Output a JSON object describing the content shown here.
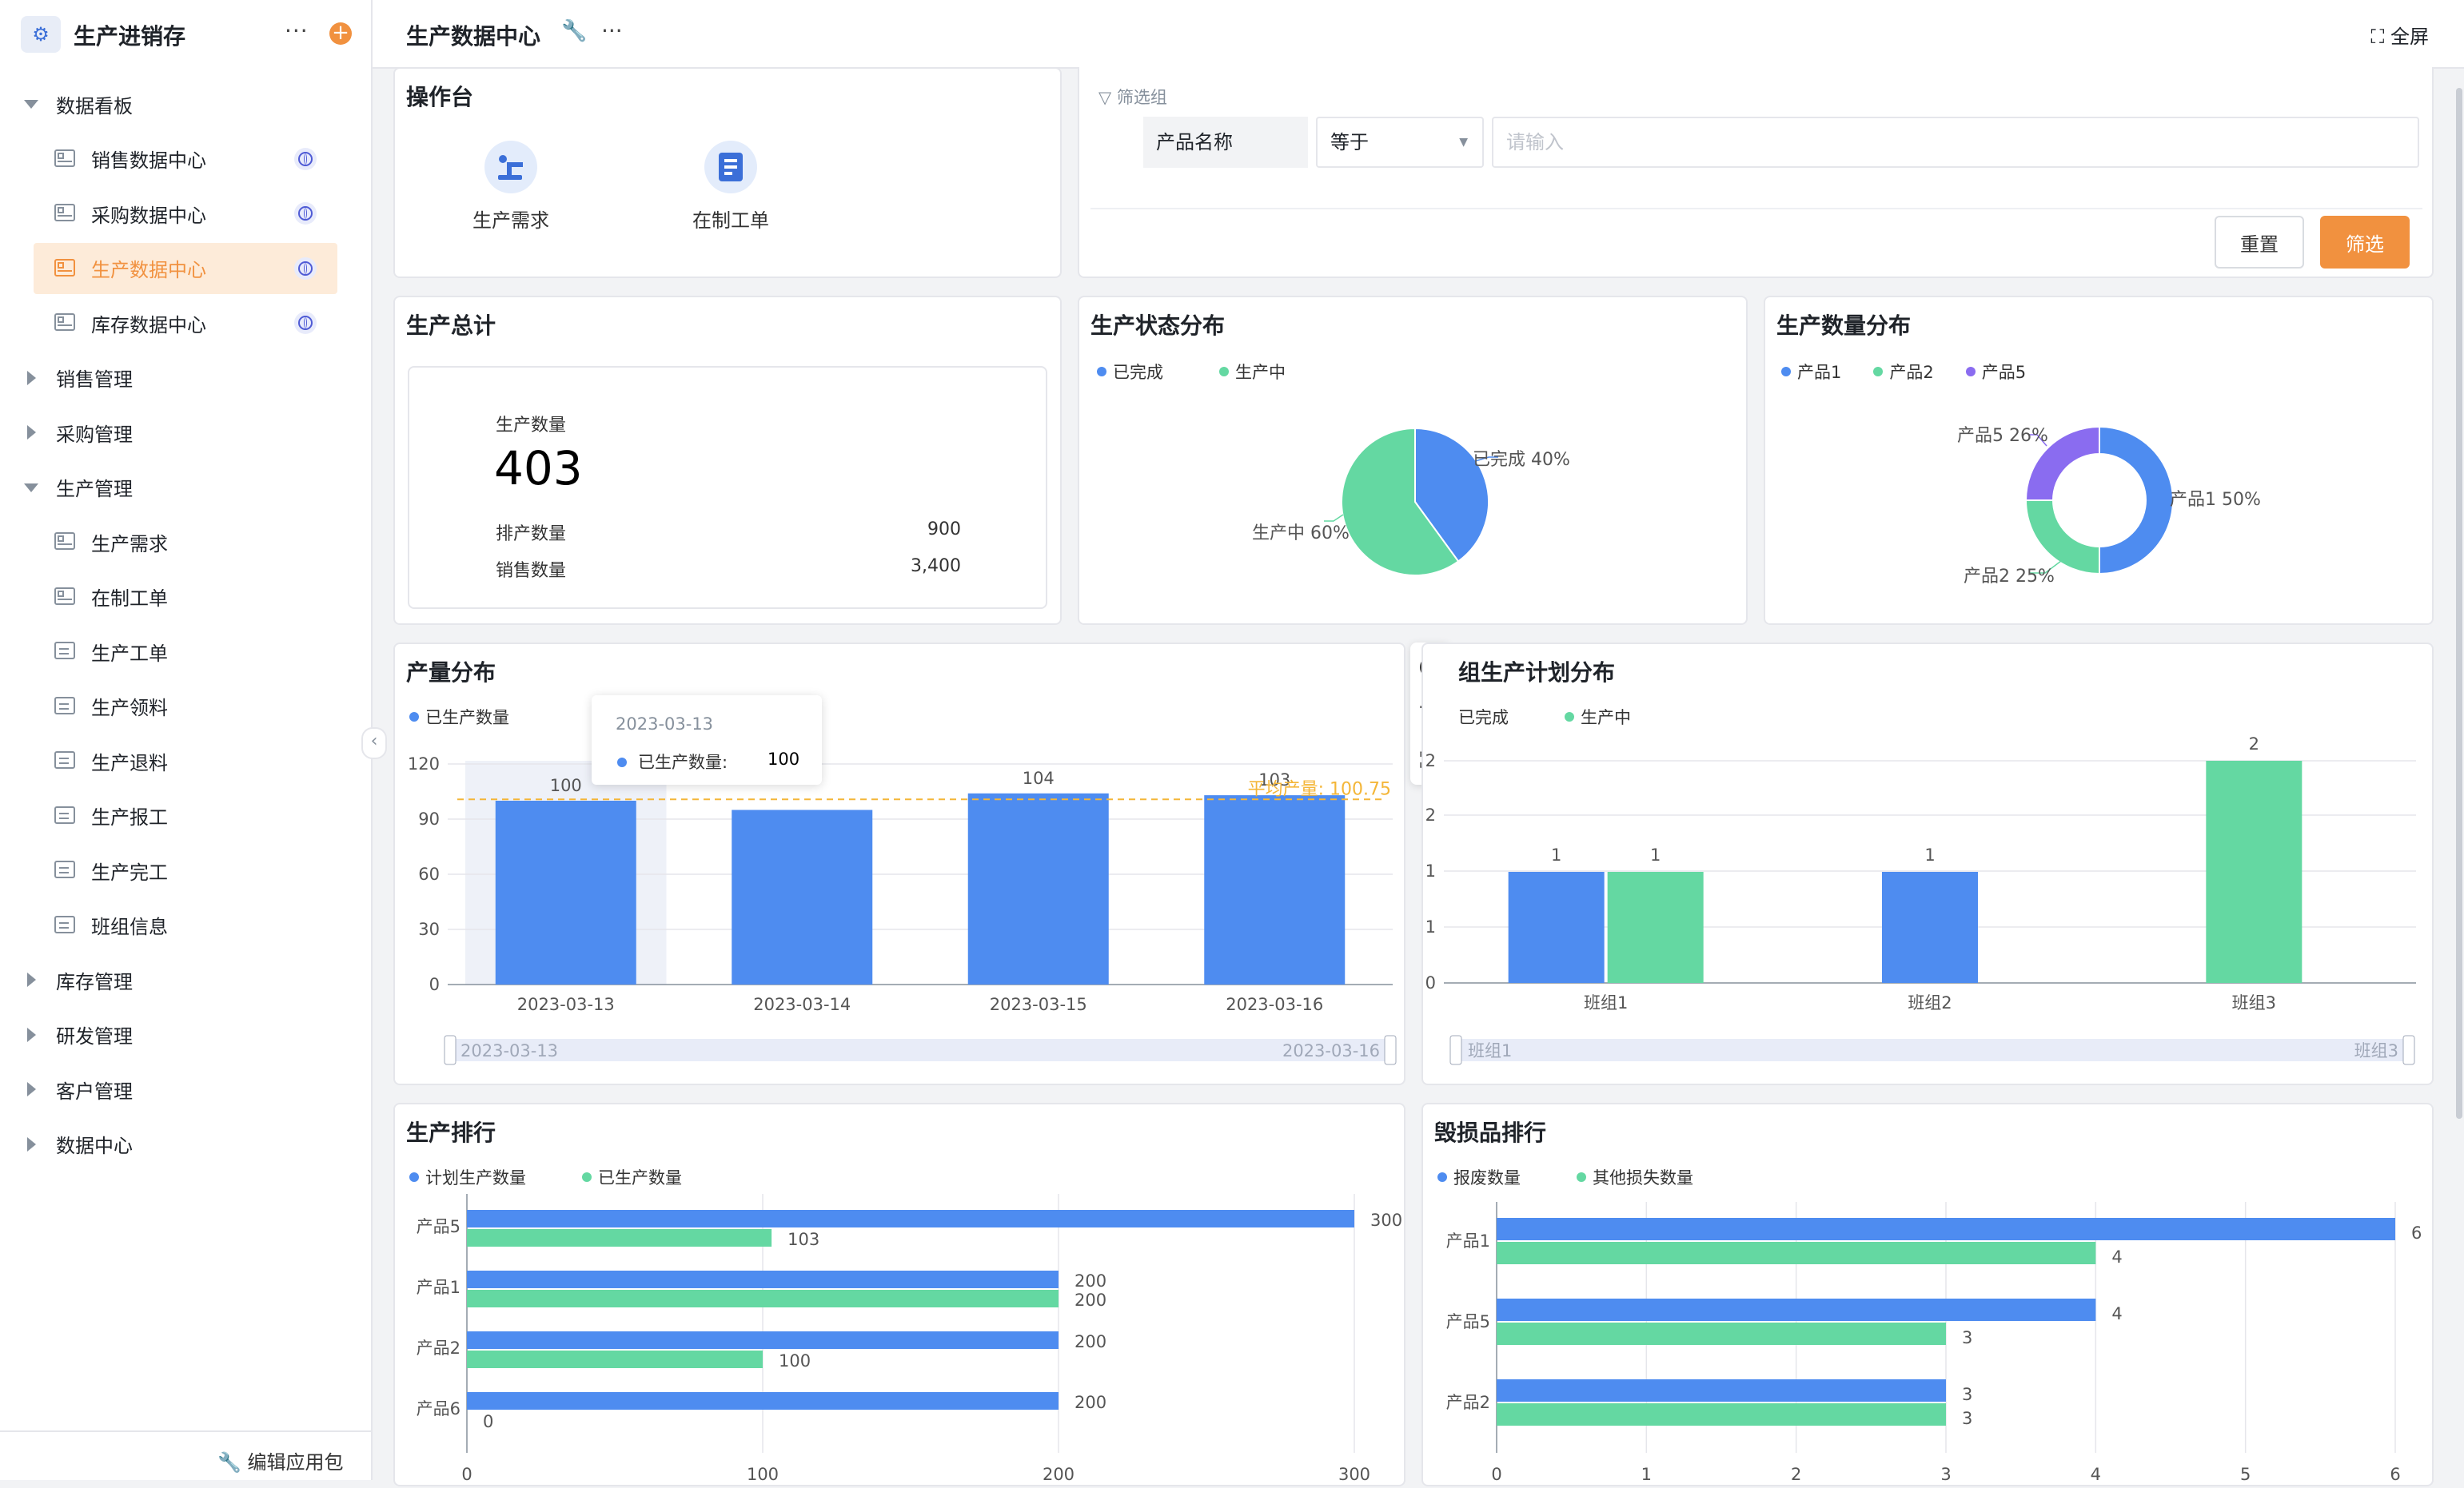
{
  "app": {
    "title": "生产进销存",
    "more": "···",
    "add": "+",
    "edit_package": "编辑应用包"
  },
  "sidebar": {
    "groups": [
      {
        "label": "数据看板",
        "expanded": true,
        "items": [
          {
            "label": "销售数据中心",
            "icon": "dashboard-icon",
            "public": true
          },
          {
            "label": "采购数据中心",
            "icon": "dashboard-icon",
            "public": true
          },
          {
            "label": "生产数据中心",
            "icon": "dashboard-icon",
            "public": true,
            "active": true
          },
          {
            "label": "库存数据中心",
            "icon": "dashboard-icon",
            "public": true
          }
        ]
      },
      {
        "label": "销售管理",
        "expanded": false,
        "items": []
      },
      {
        "label": "采购管理",
        "expanded": false,
        "items": []
      },
      {
        "label": "生产管理",
        "expanded": true,
        "items": [
          {
            "label": "生产需求",
            "icon": "dashboard-icon"
          },
          {
            "label": "在制工单",
            "icon": "dashboard-icon"
          },
          {
            "label": "生产工单",
            "icon": "form-icon"
          },
          {
            "label": "生产领料",
            "icon": "form-icon"
          },
          {
            "label": "生产退料",
            "icon": "form-icon"
          },
          {
            "label": "生产报工",
            "icon": "form-icon"
          },
          {
            "label": "生产完工",
            "icon": "form-icon"
          },
          {
            "label": "班组信息",
            "icon": "form-icon"
          }
        ]
      },
      {
        "label": "库存管理",
        "expanded": false,
        "items": []
      },
      {
        "label": "研发管理",
        "expanded": false,
        "items": []
      },
      {
        "label": "客户管理",
        "expanded": false,
        "items": []
      },
      {
        "label": "数据中心",
        "expanded": false,
        "items": []
      }
    ]
  },
  "header": {
    "title": "生产数据中心",
    "fullscreen": "全屏"
  },
  "console": {
    "title": "操作台",
    "actions": [
      {
        "label": "生产需求",
        "icon": "robot-arm-icon"
      },
      {
        "label": "在制工单",
        "icon": "document-icon"
      }
    ]
  },
  "filter": {
    "group_label": "筛选组",
    "field": "产品名称",
    "operator": "等于",
    "placeholder": "请输入",
    "reset": "重置",
    "apply": "筛选"
  },
  "colors": {
    "blue": "#4e8cf0",
    "green": "#64d8a2",
    "purple": "#8a6cf0",
    "orange": "#f1913f",
    "avg_line": "#f4b638"
  },
  "totals": {
    "title": "生产总计",
    "main_label": "生产数量",
    "main_value": "403",
    "rows": [
      {
        "label": "排产数量",
        "value": "900"
      },
      {
        "label": "销售数量",
        "value": "3,400"
      }
    ]
  },
  "status_pie": {
    "title": "生产状态分布",
    "chart_data": {
      "type": "pie",
      "slices": [
        {
          "name": "已完成",
          "value": 40,
          "label": "已完成 40%"
        },
        {
          "name": "生产中",
          "value": 60,
          "label": "生产中 60%"
        }
      ]
    }
  },
  "qty_pie": {
    "title": "生产数量分布",
    "chart_data": {
      "type": "pie",
      "donut": true,
      "slices": [
        {
          "name": "产品1",
          "value": 50,
          "label": "产品1 50%"
        },
        {
          "name": "产品2",
          "value": 25,
          "label": "产品2 25%"
        },
        {
          "name": "产品5",
          "value": 25,
          "label": "产品5 26%"
        }
      ]
    }
  },
  "output_bar": {
    "title": "产量分布",
    "chart_data": {
      "type": "bar",
      "categories": [
        "2023-03-13",
        "2023-03-14",
        "2023-03-15",
        "2023-03-16"
      ],
      "series": [
        {
          "name": "已生产数量",
          "values": [
            100,
            95,
            104,
            103
          ]
        }
      ],
      "data_labels": [
        "100",
        "",
        "104",
        "103"
      ],
      "ylim": [
        0,
        120
      ],
      "yticks": [
        "0",
        "30",
        "60",
        "90",
        "120"
      ],
      "avg_label": "平均产量: 100.75",
      "avg_value": 100.75
    },
    "tooltip": {
      "date": "2023-03-13",
      "label": "已生产数量:",
      "value": "100"
    },
    "zoom": {
      "start": "2023-03-13",
      "end": "2023-03-16"
    }
  },
  "team_bar": {
    "title": "组生产计划分布",
    "chart_data": {
      "type": "bar",
      "categories": [
        "班组1",
        "班组2",
        "班组3"
      ],
      "series": [
        {
          "name": "已完成",
          "values": [
            1,
            1,
            0
          ]
        },
        {
          "name": "生产中",
          "values": [
            1,
            0,
            2
          ]
        }
      ],
      "yticks": [
        "0",
        "1",
        "1",
        "2",
        "2"
      ],
      "ylim": [
        0,
        2
      ]
    },
    "zoom": {
      "start": "班组1",
      "end": "班组3"
    }
  },
  "rank": {
    "title": "生产排行",
    "chart_data": {
      "type": "bar",
      "orientation": "horizontal",
      "categories": [
        "产品5",
        "产品1",
        "产品2",
        "产品6"
      ],
      "series": [
        {
          "name": "计划生产数量",
          "values": [
            300,
            200,
            200,
            200
          ]
        },
        {
          "name": "已生产数量",
          "values": [
            103,
            200,
            100,
            0
          ]
        }
      ],
      "xlim": [
        0,
        300
      ],
      "xticks": [
        "0",
        "100",
        "200",
        "300"
      ]
    }
  },
  "loss": {
    "title": "毁损品排行",
    "chart_data": {
      "type": "bar",
      "orientation": "horizontal",
      "categories": [
        "产品1",
        "产品5",
        "产品2"
      ],
      "series": [
        {
          "name": "报废数量",
          "values": [
            6,
            4,
            3
          ]
        },
        {
          "name": "其他损失数量",
          "values": [
            4,
            3,
            3
          ]
        }
      ],
      "xlim": [
        0,
        6
      ],
      "xticks": [
        "0",
        "1",
        "2",
        "3",
        "4",
        "5",
        "6"
      ]
    }
  }
}
